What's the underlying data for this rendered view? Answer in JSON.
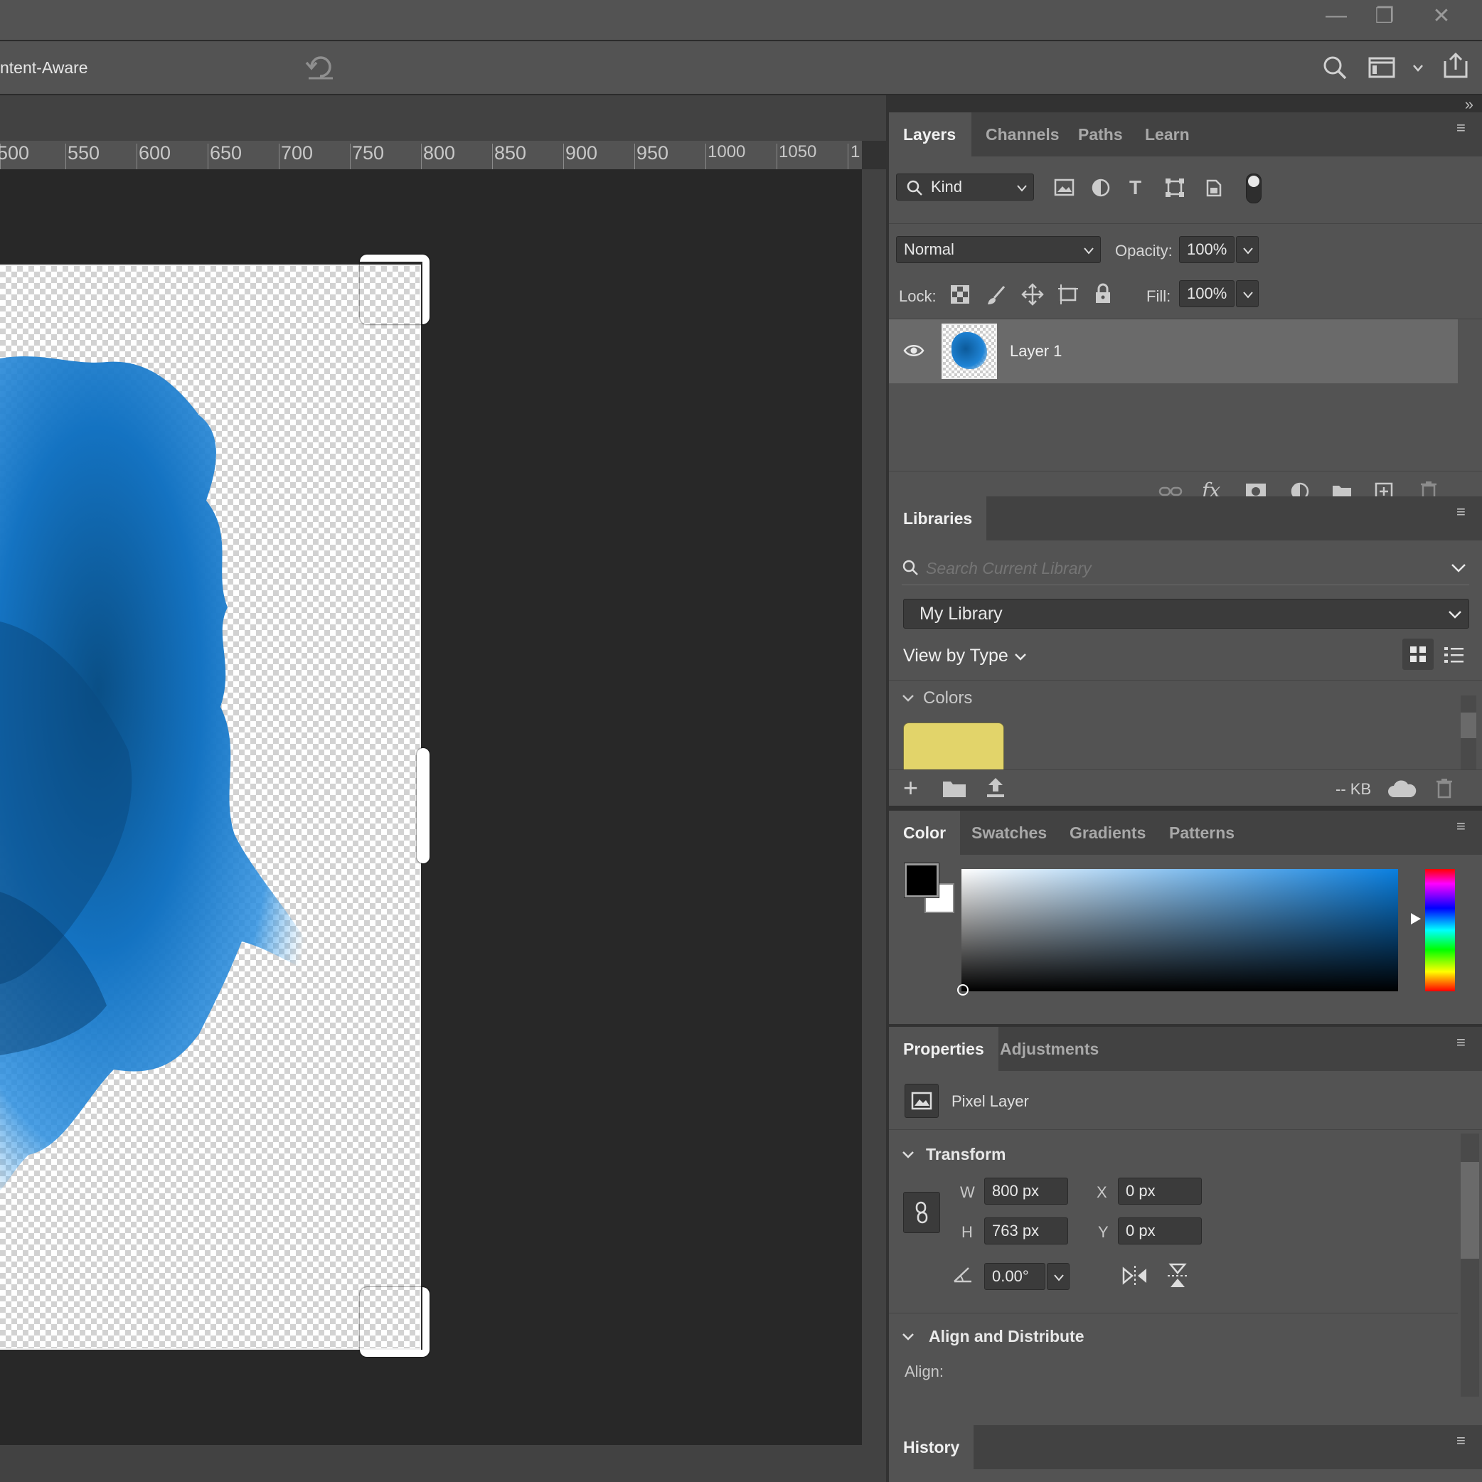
{
  "window": {
    "controls": {
      "minimize": "—",
      "restore": "❐",
      "close": "✕"
    }
  },
  "options_bar": {
    "content_aware_label": "ntent-Aware",
    "undo_icon": "rotate-ccw-icon"
  },
  "ruler": {
    "ticks": [
      "500",
      "550",
      "600",
      "650",
      "700",
      "750",
      "800",
      "850",
      "900",
      "950",
      "1000",
      "1050",
      "1"
    ]
  },
  "layers_panel": {
    "tabs": [
      "Layers",
      "Channels",
      "Paths",
      "Learn"
    ],
    "active_tab": "Layers",
    "filter_kind": "Kind",
    "blend_mode": "Normal",
    "opacity_label": "Opacity:",
    "opacity_value": "100%",
    "lock_label": "Lock:",
    "fill_label": "Fill:",
    "fill_value": "100%",
    "layers": [
      {
        "name": "Layer 1",
        "visible": true,
        "selected": true
      }
    ]
  },
  "libraries_panel": {
    "tab": "Libraries",
    "search_placeholder": "Search Current Library",
    "library_name": "My Library",
    "view_by": "View by Type",
    "section_colors": "Colors",
    "color_swatch": "#e2d46a",
    "size_label": "-- KB"
  },
  "color_panel": {
    "tabs": [
      "Color",
      "Swatches",
      "Gradients",
      "Patterns"
    ],
    "active_tab": "Color",
    "foreground": "#000000",
    "background": "#ffffff",
    "hue_color": "#0a7fdf"
  },
  "properties_panel": {
    "tabs": [
      "Properties",
      "Adjustments"
    ],
    "active_tab": "Properties",
    "type_label": "Pixel Layer",
    "transform_label": "Transform",
    "w_label": "W",
    "w_value": "800 px",
    "h_label": "H",
    "h_value": "763 px",
    "x_label": "X",
    "x_value": "0 px",
    "y_label": "Y",
    "y_value": "0 px",
    "angle_value": "0.00°",
    "align_label": "Align and Distribute",
    "align_sub": "Align:"
  },
  "history_panel": {
    "tab": "History"
  }
}
